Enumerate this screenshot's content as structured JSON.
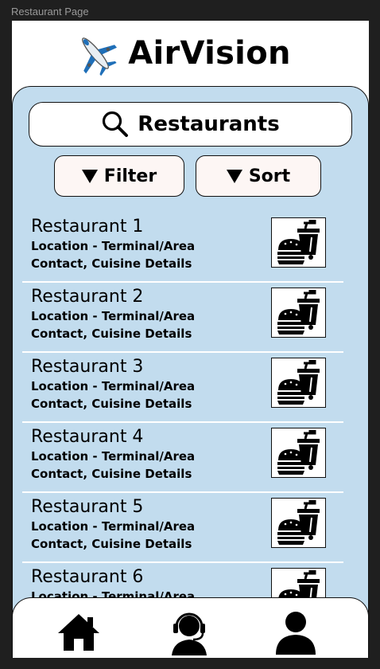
{
  "frame": {
    "label": "Restaurant Page"
  },
  "header": {
    "title": "AirVision",
    "logo_icon": "airplane-icon"
  },
  "search": {
    "label": "Restaurants",
    "icon": "search-icon"
  },
  "controls": {
    "filter_label": "Filter",
    "sort_label": "Sort"
  },
  "restaurants": [
    {
      "name": "Restaurant 1",
      "location": "Location - Terminal/Area",
      "details": "Contact, Cuisine Details"
    },
    {
      "name": "Restaurant 2",
      "location": "Location - Terminal/Area",
      "details": "Contact, Cuisine Details"
    },
    {
      "name": "Restaurant 3",
      "location": "Location - Terminal/Area",
      "details": "Contact, Cuisine Details"
    },
    {
      "name": "Restaurant 4",
      "location": "Location - Terminal/Area",
      "details": "Contact, Cuisine Details"
    },
    {
      "name": "Restaurant 5",
      "location": "Location - Terminal/Area",
      "details": "Contact, Cuisine Details"
    },
    {
      "name": "Restaurant 6",
      "location": "Location - Terminal/Area",
      "details": ""
    }
  ],
  "navbar": {
    "items": [
      "home-icon",
      "support-headset-icon",
      "profile-icon"
    ]
  },
  "colors": {
    "panel": "#c2dcee",
    "button_bg": "#fdf6f4",
    "plane_blue": "#1f6fb8"
  }
}
